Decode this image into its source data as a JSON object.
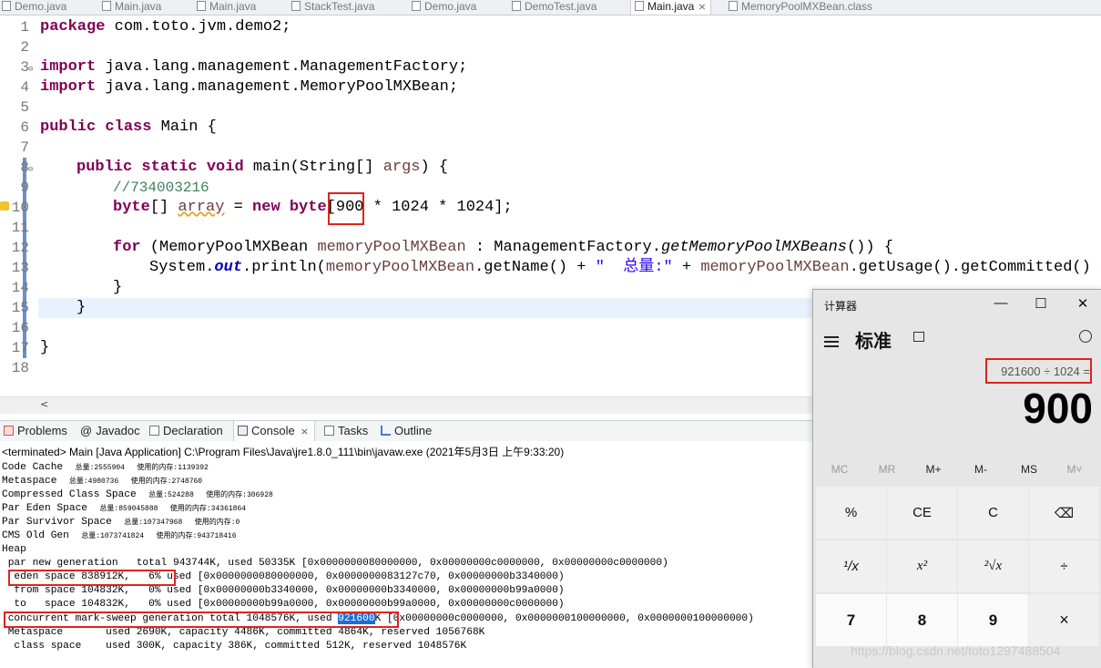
{
  "tabs": [
    {
      "label": "Demo.java"
    },
    {
      "label": "Main.java"
    },
    {
      "label": "Main.java"
    },
    {
      "label": "StackTest.java"
    },
    {
      "label": "Demo.java"
    },
    {
      "label": "DemoTest.java"
    },
    {
      "label": "Main.java",
      "close": "⨯"
    },
    {
      "label": "MemoryPoolMXBean.class"
    }
  ],
  "editor": {
    "line_numbers": [
      "1",
      "2",
      "3",
      "4",
      "5",
      "6",
      "7",
      "8",
      "9",
      "10",
      "11",
      "12",
      "13",
      "14",
      "15",
      "16",
      "17",
      "18"
    ],
    "l1a": "package",
    "l1b": " com.toto.jvm.demo2;",
    "l3a": "import",
    "l3b": " java.lang.management.ManagementFactory;",
    "l4a": "import",
    "l4b": " java.lang.management.MemoryPoolMXBean;",
    "l6a": "public",
    "l6b": " ",
    "l6c": "class",
    "l6d": " Main {",
    "l8a": "public",
    "l8b": "static",
    "l8c": "void",
    "l8d": " main(String[] ",
    "l8e": "args",
    "l8f": ") {",
    "l9": "//734003216",
    "l10a": "byte",
    "l10b": "[] ",
    "l10c": "array",
    "l10d": " = ",
    "l10e": "new",
    "l10f": " ",
    "l10g": "byte",
    "l10h": "[900 * 1024 * 1024];",
    "l12a": "for",
    "l12b": " (MemoryPoolMXBean ",
    "l12c": "memoryPoolMXBean",
    "l12d": " : ManagementFactory.",
    "l12e": "getMemoryPoolMXBeans",
    "l12f": "()) {",
    "l13a": "System.",
    "l13b": "out",
    "l13c": ".println(",
    "l13d": "memoryPoolMXBean",
    "l13e": ".getName() + ",
    "l13f": "\"  总量:\"",
    "l13g": " + ",
    "l13h": "memoryPoolMXBean",
    "l13i": ".getUsage().getCommitted() + ",
    "l14": "}",
    "l15": "}",
    "l17": "}"
  },
  "views": {
    "problems": "Problems",
    "javadoc": "Javadoc",
    "declaration": "Declaration",
    "console": "Console",
    "console_close": "⨯",
    "tasks": "Tasks",
    "outline": "Outline"
  },
  "console": {
    "terminated": "<terminated> Main [Java Application] C:\\Program Files\\Java\\jre1.8.0_111\\bin\\javaw.exe (2021年5月3日 上午9:33:20)",
    "pools": [
      {
        "name": "Code Cache  ",
        "total": "总量:2555904",
        "used": "使用的内存:1139392"
      },
      {
        "name": "Metaspace  ",
        "total": "总量:4980736",
        "used": "使用的内存:2748760"
      },
      {
        "name": "Compressed Class Space  ",
        "total": "总量:524288",
        "used": "使用的内存:306928"
      },
      {
        "name": "Par Eden Space  ",
        "total": "总量:859045888",
        "used": "使用的内存:34361864"
      },
      {
        "name": "Par Survivor Space  ",
        "total": "总量:107347968",
        "used": "使用的内存:0"
      },
      {
        "name": "CMS Old Gen  ",
        "total": "总量:1073741824",
        "used": "使用的内存:943718416"
      }
    ],
    "heap": "Heap",
    "parnew": " par new generation   total 943744K, used 50335K [0x0000000080000000, 0x00000000c0000000, 0x00000000c0000000)",
    "eden_a": "  eden space 838912K,   6%",
    "eden_b": " used [0x0000000080000000, 0x0000000083127c70, 0x00000000b3340000)",
    "from": "  from space 104832K,   0% used [0x00000000b3340000, 0x00000000b3340000, 0x00000000b99a0000)",
    "to": "  to   space 104832K,   0% used [0x00000000b99a0000, 0x00000000b99a0000, 0x00000000c0000000)",
    "cms_a": " concurrent mark-sweep generation total 1048576K, used ",
    "cms_sel": "921600",
    "cms_b": "K",
    "cms_c": " [0x00000000c0000000, 0x0000000100000000, 0x0000000100000000)",
    "meta": " Metaspace       used 2690K, capacity 4486K, committed 4864K, reserved 1056768K",
    "klass": "  class space    used 300K, capacity 386K, committed 512K, reserved 1048576K"
  },
  "calculator": {
    "title": "计算器",
    "minimize": "—",
    "maximize": "☐",
    "close": "✕",
    "mode": "标准",
    "expression": "921600 ÷ 1024 =",
    "result": "900",
    "memory": [
      "MC",
      "MR",
      "M+",
      "M-",
      "MS",
      "M˅"
    ],
    "keys": [
      "%",
      "CE",
      "C",
      "⌫",
      "¹/x",
      "x²",
      "²√x",
      "÷",
      "7",
      "8",
      "9",
      "×"
    ]
  },
  "watermark": "https://blog.csdn.net/toto1297488504"
}
